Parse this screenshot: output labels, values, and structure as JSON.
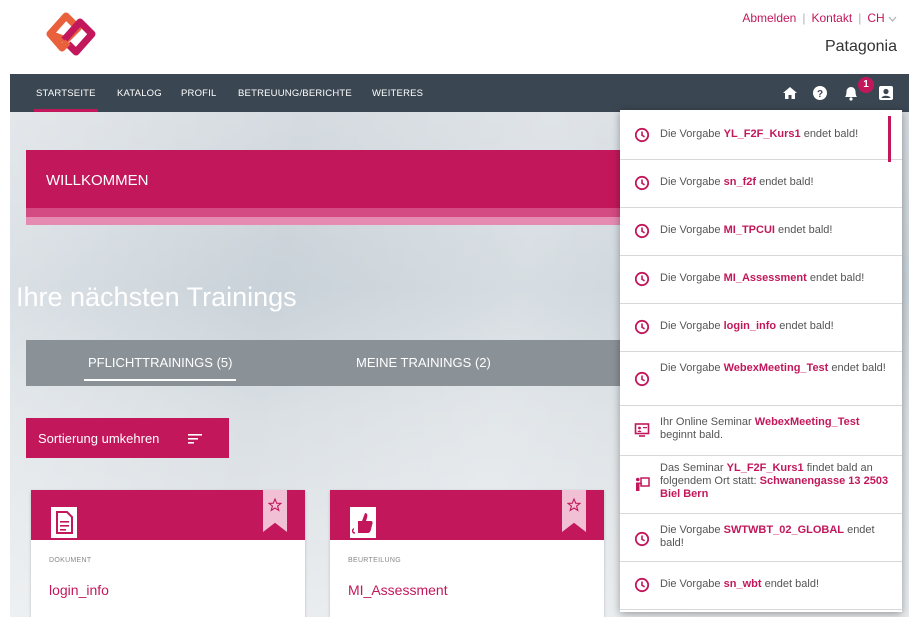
{
  "header": {
    "links": [
      "Abmelden",
      "Kontakt",
      "CH"
    ],
    "organization": "Patagonia"
  },
  "nav": {
    "items": [
      "STARTSEITE",
      "KATALOG",
      "PROFIL",
      "BETREUUNG/BERICHTE",
      "WEITERES"
    ],
    "notification_count": "1",
    "icons": [
      "home-icon",
      "help-icon",
      "bell-icon",
      "user-icon"
    ]
  },
  "hero": {
    "welcome": "WILLKOMMEN",
    "trainings_title": "Ihre nächsten Trainings",
    "tabs": [
      "PFLICHTTRAININGS (5)",
      "MEINE TRAININGS (2)"
    ],
    "sort_button": "Sortierung umkehren"
  },
  "cards": [
    {
      "type": "DOKUMENT",
      "title": "login_info",
      "icon": "document-icon"
    },
    {
      "type": "BEURTEILUNG",
      "title": "MI_Assessment",
      "icon": "thumbs-up-icon"
    }
  ],
  "notifications": [
    {
      "icon": "clock-icon",
      "pre": "Die Vorgabe ",
      "hl": "YL_F2F_Kurs1",
      "post": " endet bald!"
    },
    {
      "icon": "clock-icon",
      "pre": "Die Vorgabe ",
      "hl": "sn_f2f",
      "post": " endet bald!"
    },
    {
      "icon": "clock-icon",
      "pre": "Die Vorgabe ",
      "hl": "MI_TPCUI",
      "post": " endet bald!"
    },
    {
      "icon": "clock-icon",
      "pre": "Die Vorgabe ",
      "hl": "MI_Assessment",
      "post": " endet bald!"
    },
    {
      "icon": "clock-icon",
      "pre": "Die Vorgabe ",
      "hl": "login_info",
      "post": " endet bald!"
    },
    {
      "icon": "clock-icon",
      "pre": "Die Vorgabe ",
      "hl": "WebexMeeting_Test",
      "post": " endet bald!"
    },
    {
      "icon": "webinar-icon",
      "pre": "Ihr Online Seminar ",
      "hl": "WebexMeeting_Test",
      "post": " beginnt bald."
    },
    {
      "icon": "presenter-icon",
      "pre": "Das Seminar ",
      "hl": "YL_F2F_Kurs1",
      "post": " findet bald an folgendem Ort statt: ",
      "hl2": "Schwanengasse 13 2503 Biel Bern"
    },
    {
      "icon": "clock-icon",
      "pre": "Die Vorgabe ",
      "hl": "SWTWBT_02_GLOBAL",
      "post": " endet bald!"
    },
    {
      "icon": "clock-icon",
      "pre": "Die Vorgabe ",
      "hl": "sn_wbt",
      "post": " endet bald!"
    }
  ],
  "colors": {
    "accent": "#c2185b",
    "nav_bg": "#3a4651",
    "tabbar_bg": "#8a9197"
  }
}
